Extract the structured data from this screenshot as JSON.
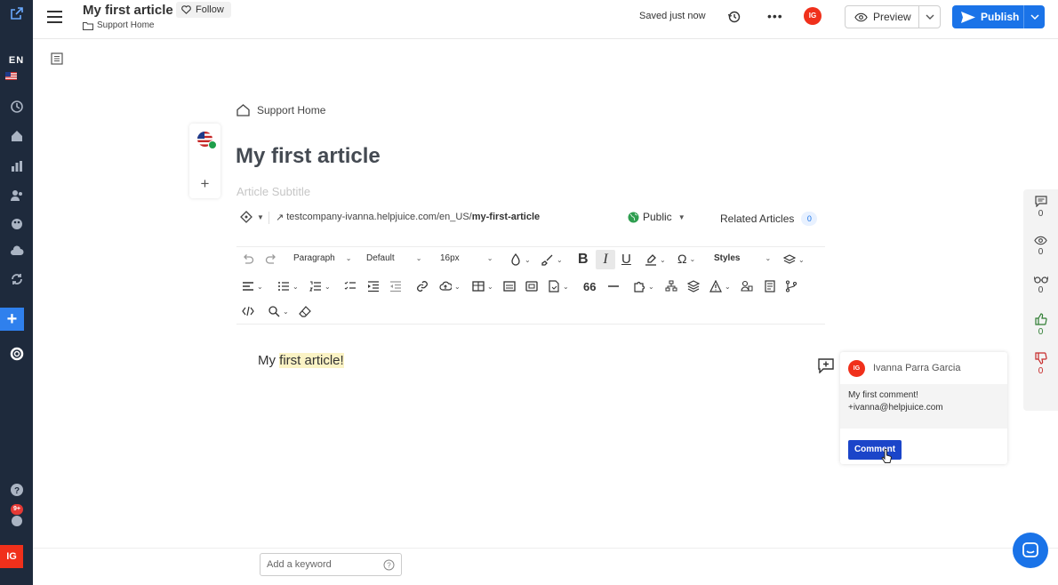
{
  "app": {
    "lang_code": "EN",
    "notifications_badge": "9+",
    "user_initials": "IG"
  },
  "header": {
    "title": "My first article",
    "follow_label": "Follow",
    "breadcrumb": "Support Home",
    "save_status": "Saved just now",
    "more_label": "•••",
    "preview_label": "Preview",
    "publish_label": "Publish"
  },
  "article": {
    "breadcrumb": "Support Home",
    "title": "My first article",
    "subtitle_placeholder": "Article Subtitle",
    "url_prefix": "testcompany-ivanna.helpjuice.com/en_US/",
    "url_slug": "my-first-article",
    "visibility": "Public",
    "related_label": "Related Articles",
    "related_count": "0"
  },
  "toolbar": {
    "block_format": "Paragraph",
    "font_family": "Default",
    "font_size": "16px",
    "styles": "Styles"
  },
  "content": {
    "text_before": "My ",
    "text_highlight": "first article!"
  },
  "comment": {
    "author": "Ivanna Parra Garcia",
    "author_initials": "IG",
    "text_line1": "My first comment!",
    "text_line2": "+ivanna@helpjuice.com",
    "button_label": "Comment"
  },
  "stats": {
    "comments": "0",
    "views": "0",
    "readers": "0",
    "likes": "0",
    "dislikes": "0",
    "colors": {
      "likes": "#2e7d32",
      "dislikes": "#c62828"
    }
  },
  "footer": {
    "keyword_placeholder": "Add a keyword"
  }
}
